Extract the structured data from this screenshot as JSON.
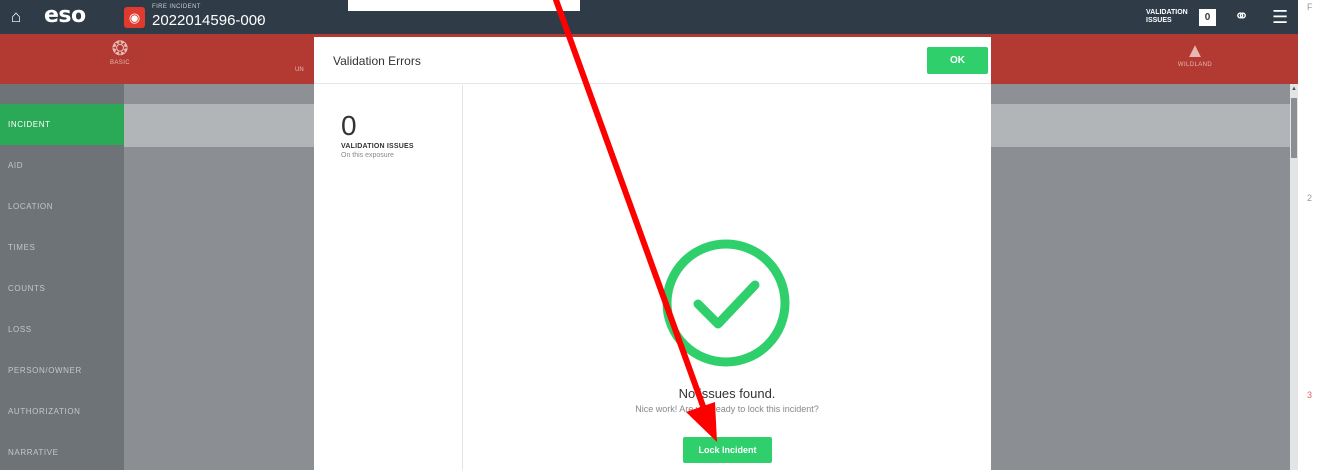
{
  "topbar": {
    "home_icon": "home-icon",
    "logo": "eso",
    "incident_label": "FIRE INCIDENT",
    "incident_number": "2022014596-000",
    "validation_label_line1": "VALIDATION",
    "validation_label_line2": "ISSUES",
    "validation_count": "0"
  },
  "modules": {
    "basic": "BASIC",
    "unit_partial": "UN",
    "wildland": "WILDLAND"
  },
  "sidebar": {
    "items": [
      {
        "label": "INCIDENT",
        "active": true
      },
      {
        "label": "AID",
        "active": false
      },
      {
        "label": "LOCATION",
        "active": false
      },
      {
        "label": "TIMES",
        "active": false
      },
      {
        "label": "COUNTS",
        "active": false
      },
      {
        "label": "LOSS",
        "active": false
      },
      {
        "label": "PERSON/OWNER",
        "active": false
      },
      {
        "label": "AUTHORIZATION",
        "active": false
      },
      {
        "label": "NARRATIVE",
        "active": false
      }
    ]
  },
  "modal": {
    "title": "Validation Errors",
    "ok_label": "OK",
    "issue_count": "0",
    "issue_label": "VALIDATION ISSUES",
    "issue_sub": "On this exposure",
    "message_title": "No issues found.",
    "message_sub": "Nice work! Are you ready to lock this incident?",
    "lock_label": "Lock Incident"
  },
  "right_edge": {
    "mark_top": "F",
    "mark_mid": "2",
    "mark_low": "3"
  },
  "colors": {
    "topbar": "#2f3b47",
    "module_bar": "#b33a33",
    "accent_green": "#2fcf6b",
    "sidebar_active": "#2aaa57",
    "annotation_arrow": "#ff0000"
  }
}
